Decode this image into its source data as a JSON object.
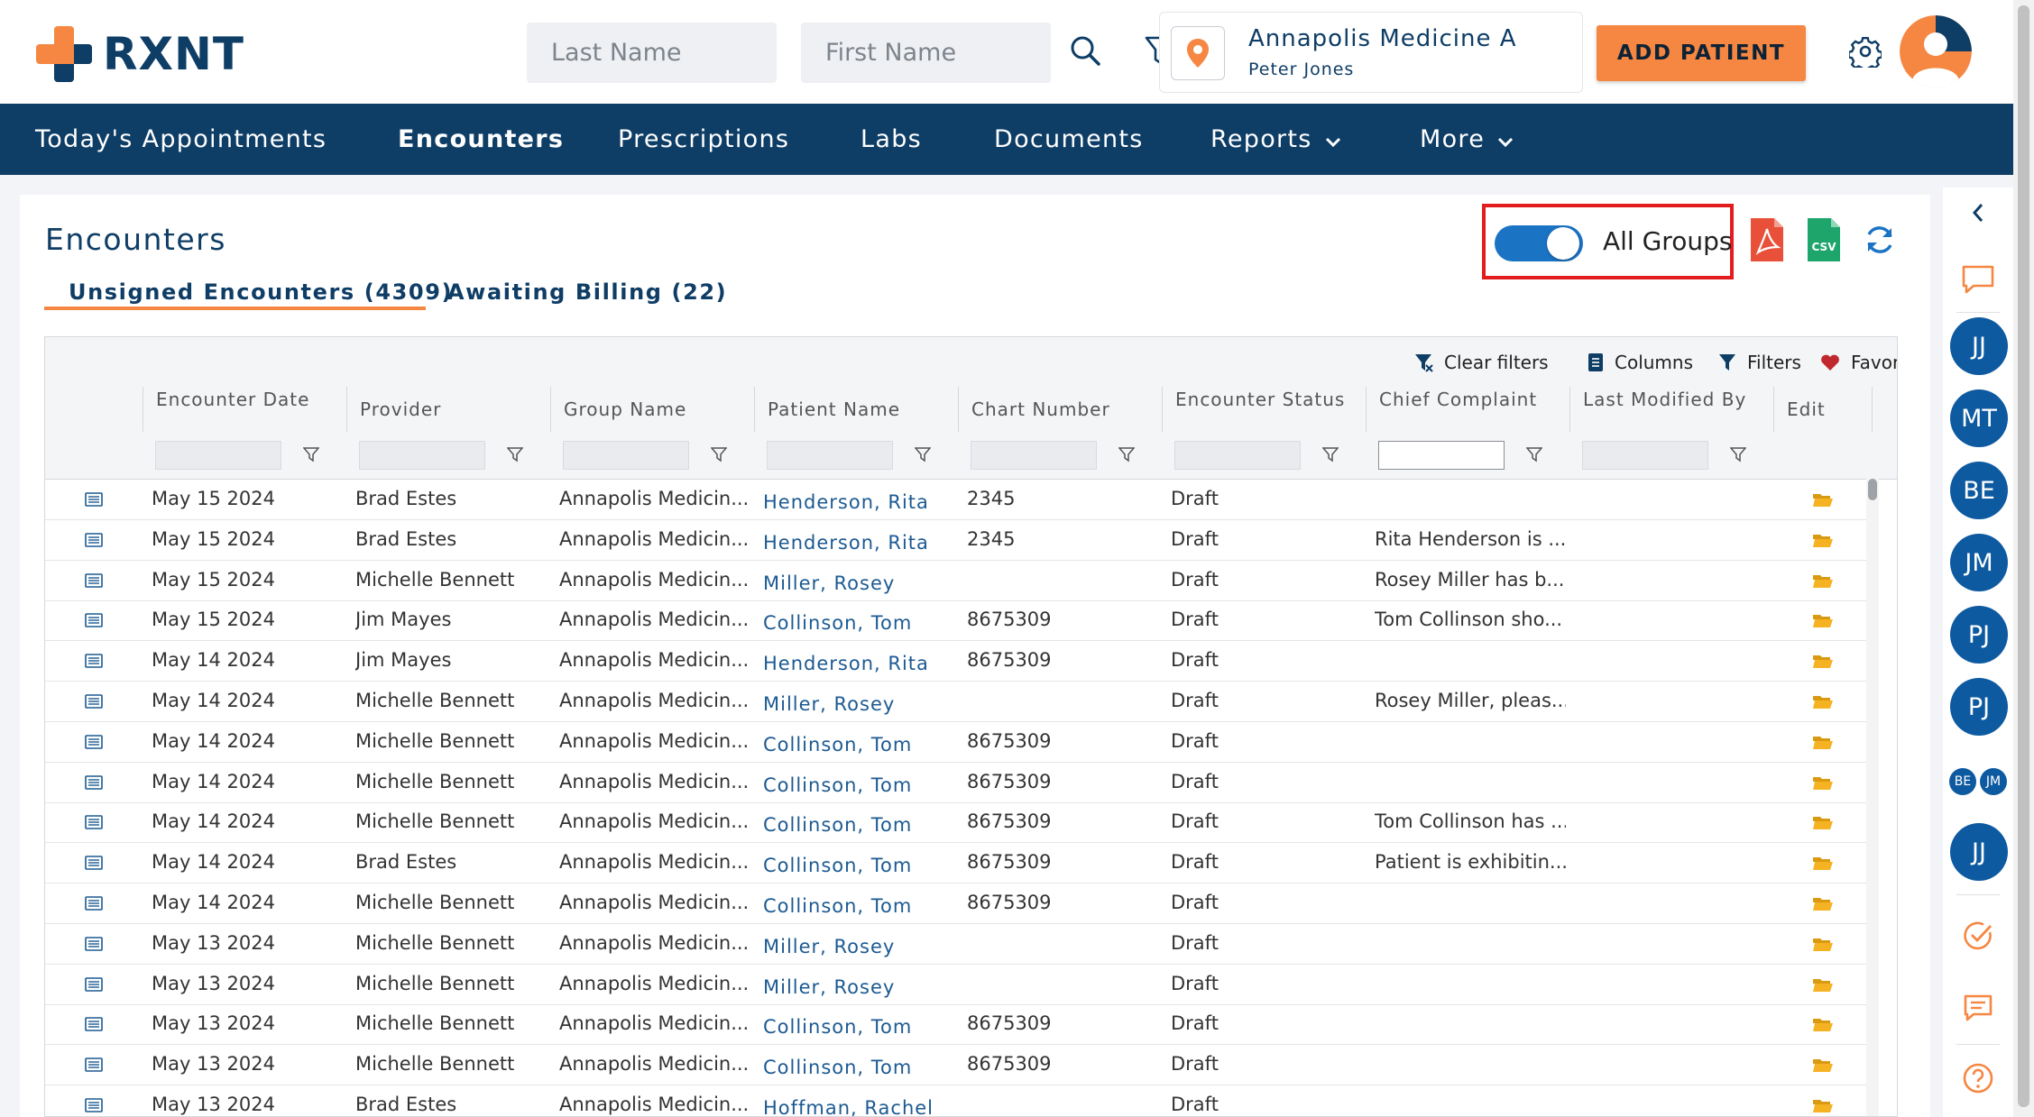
{
  "brand": {
    "name": "RXNT"
  },
  "search": {
    "last_name_placeholder": "Last Name",
    "first_name_placeholder": "First Name"
  },
  "location": {
    "name": "Annapolis Medicine A",
    "user": "Peter Jones"
  },
  "header": {
    "add_patient_label": "ADD PATIENT"
  },
  "nav": {
    "items": [
      {
        "label": "Today's Appointments"
      },
      {
        "label": "Encounters"
      },
      {
        "label": "Prescriptions"
      },
      {
        "label": "Labs"
      },
      {
        "label": "Documents"
      },
      {
        "label": "Reports"
      },
      {
        "label": "More"
      }
    ]
  },
  "page": {
    "title": "Encounters",
    "tabs": [
      {
        "label": "Unsigned Encounters (4309)"
      },
      {
        "label": "Awaiting Billing (22)"
      }
    ],
    "toggle": {
      "label": "All Groups",
      "on": true
    }
  },
  "toolbar": {
    "clear_filters": "Clear filters",
    "columns": "Columns",
    "filters": "Filters",
    "favorites": "Favorites"
  },
  "columns": {
    "encounter_date": "Encounter Date",
    "provider": "Provider",
    "group_name": "Group Name",
    "patient_name": "Patient Name",
    "chart_number": "Chart Number",
    "encounter_status": "Encounter Status",
    "chief_complaint": "Chief Complaint",
    "last_modified_by": "Last Modified By",
    "edit": "Edit"
  },
  "rows": [
    {
      "date": "May 15 2024",
      "provider": "Brad Estes",
      "group": "Annapolis Medicin...",
      "patient": "Henderson, Rita",
      "chart": "2345",
      "status": "Draft",
      "complaint": ""
    },
    {
      "date": "May 15 2024",
      "provider": "Brad Estes",
      "group": "Annapolis Medicin...",
      "patient": "Henderson, Rita",
      "chart": "2345",
      "status": "Draft",
      "complaint": "Rita Henderson is ..."
    },
    {
      "date": "May 15 2024",
      "provider": "Michelle Bennett",
      "group": "Annapolis Medicin...",
      "patient": "Miller, Rosey",
      "chart": "",
      "status": "Draft",
      "complaint": "Rosey Miller has b..."
    },
    {
      "date": "May 15 2024",
      "provider": "Jim Mayes",
      "group": "Annapolis Medicin...",
      "patient": "Collinson, Tom",
      "chart": "8675309",
      "status": "Draft",
      "complaint": "Tom Collinson sho..."
    },
    {
      "date": "May 14 2024",
      "provider": "Jim Mayes",
      "group": "Annapolis Medicin...",
      "patient": "Henderson, Rita",
      "chart": "8675309",
      "status": "Draft",
      "complaint": ""
    },
    {
      "date": "May 14 2024",
      "provider": "Michelle Bennett",
      "group": "Annapolis Medicin...",
      "patient": "Miller, Rosey",
      "chart": "",
      "status": "Draft",
      "complaint": "Rosey Miller, pleas..."
    },
    {
      "date": "May 14 2024",
      "provider": "Michelle Bennett",
      "group": "Annapolis Medicin...",
      "patient": "Collinson, Tom",
      "chart": "8675309",
      "status": "Draft",
      "complaint": ""
    },
    {
      "date": "May 14 2024",
      "provider": "Michelle Bennett",
      "group": "Annapolis Medicin...",
      "patient": "Collinson, Tom",
      "chart": "8675309",
      "status": "Draft",
      "complaint": ""
    },
    {
      "date": "May 14 2024",
      "provider": "Michelle Bennett",
      "group": "Annapolis Medicin...",
      "patient": "Collinson, Tom",
      "chart": "8675309",
      "status": "Draft",
      "complaint": "Tom Collinson has ..."
    },
    {
      "date": "May 14 2024",
      "provider": "Brad Estes",
      "group": "Annapolis Medicin...",
      "patient": "Collinson, Tom",
      "chart": "8675309",
      "status": "Draft",
      "complaint": "Patient is exhibitin..."
    },
    {
      "date": "May 14 2024",
      "provider": "Michelle Bennett",
      "group": "Annapolis Medicin...",
      "patient": "Collinson, Tom",
      "chart": "8675309",
      "status": "Draft",
      "complaint": ""
    },
    {
      "date": "May 13 2024",
      "provider": "Michelle Bennett",
      "group": "Annapolis Medicin...",
      "patient": "Miller, Rosey",
      "chart": "",
      "status": "Draft",
      "complaint": ""
    },
    {
      "date": "May 13 2024",
      "provider": "Michelle Bennett",
      "group": "Annapolis Medicin...",
      "patient": "Miller, Rosey",
      "chart": "",
      "status": "Draft",
      "complaint": ""
    },
    {
      "date": "May 13 2024",
      "provider": "Michelle Bennett",
      "group": "Annapolis Medicin...",
      "patient": "Collinson, Tom",
      "chart": "8675309",
      "status": "Draft",
      "complaint": ""
    },
    {
      "date": "May 13 2024",
      "provider": "Michelle Bennett",
      "group": "Annapolis Medicin...",
      "patient": "Collinson, Tom",
      "chart": "8675309",
      "status": "Draft",
      "complaint": ""
    },
    {
      "date": "May 13 2024",
      "provider": "Brad Estes",
      "group": "Annapolis Medicin...",
      "patient": "Hoffman, Rachel",
      "chart": "",
      "status": "Draft",
      "complaint": ""
    }
  ],
  "rail": {
    "avatars": [
      {
        "initials": "JJ"
      },
      {
        "initials": "MT"
      },
      {
        "initials": "BE"
      },
      {
        "initials": "JM"
      },
      {
        "initials": "PJ"
      },
      {
        "initials": "PJ"
      }
    ],
    "small_avatars": [
      {
        "initials": "BE"
      },
      {
        "initials": "JM"
      }
    ],
    "last_avatar": {
      "initials": "JJ"
    }
  },
  "icons": {
    "search": "search-icon",
    "filter": "filter-icon",
    "location": "map-pin-icon",
    "settings": "gear-icon",
    "pdf": "pdf-icon",
    "csv": "csv-icon",
    "refresh": "refresh-icon",
    "chat": "chat-icon",
    "tasks": "check-circle-icon",
    "messages": "message-icon",
    "help": "help-icon",
    "edit": "folder-icon",
    "row": "document-icon"
  },
  "colors": {
    "primary": "#0e3d66",
    "accent": "#f58742",
    "link": "#1c5a92",
    "toggle": "#1b73c4",
    "highlight": "#e31d1d",
    "pdf": "#e8503a",
    "csv": "#1ea56b"
  }
}
